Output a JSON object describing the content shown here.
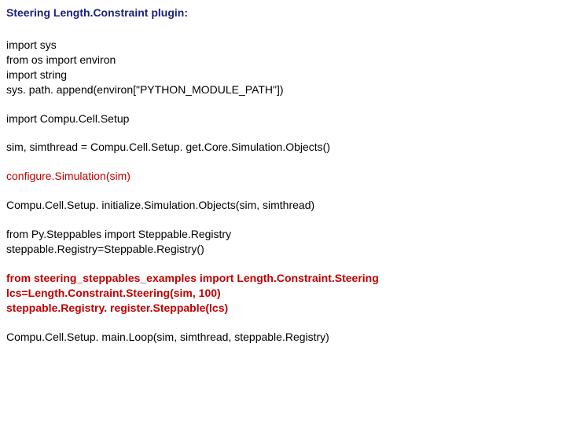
{
  "title": "Steering Length.Constraint plugin:",
  "b1": {
    "l1": "import sys",
    "l2": "from os import environ",
    "l3": "import string",
    "l4": "sys. path. append(environ[\"PYTHON_MODULE_PATH\"])"
  },
  "b2": {
    "l1": "import Compu.Cell.Setup"
  },
  "b3": {
    "l1": "sim, simthread = Compu.Cell.Setup. get.Core.Simulation.Objects()"
  },
  "b4": {
    "l1": "configure.Simulation(sim)"
  },
  "b5": {
    "l1": "Compu.Cell.Setup. initialize.Simulation.Objects(sim, simthread)"
  },
  "b6": {
    "l1": "from Py.Steppables import Steppable.Registry",
    "l2": "steppable.Registry=Steppable.Registry()"
  },
  "b7": {
    "l1": "from steering_steppables_examples import Length.Constraint.Steering",
    "l2": "lcs=Length.Constraint.Steering(sim, 100)",
    "l3": "steppable.Registry. register.Steppable(lcs)"
  },
  "b8": {
    "l1": "Compu.Cell.Setup. main.Loop(sim, simthread, steppable.Registry)"
  }
}
